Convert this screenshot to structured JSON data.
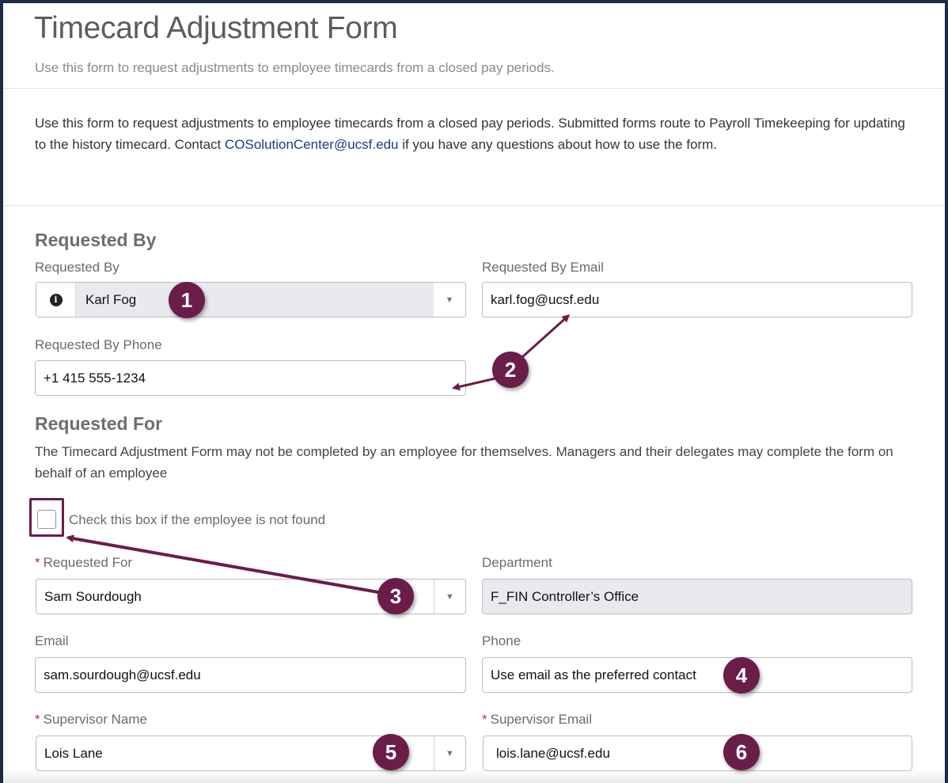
{
  "header": {
    "title": "Timecard Adjustment Form",
    "subtitle": "Use this form to request adjustments to employee timecards from a closed pay periods."
  },
  "intro": {
    "text_before": "Use this form to request adjustments to employee timecards from a closed pay periods. Submitted forms route to Payroll Timekeeping for updating to the history timecard. Contact ",
    "email_link": "COSolutionCenter@ucsf.edu",
    "text_after": " if you have any questions about how to use the form."
  },
  "requested_by": {
    "section_title": "Requested By",
    "name_label": "Requested By",
    "name_value": "Karl Fog",
    "email_label": "Requested By Email",
    "email_value": "karl.fog@ucsf.edu",
    "phone_label": "Requested By Phone",
    "phone_value": "+1 415 555-1234"
  },
  "requested_for": {
    "section_title": "Requested For",
    "description": "The Timecard Adjustment Form may not be completed by an employee for themselves. Managers and their delegates may complete the form on behalf of an employee",
    "checkbox_label": "Check this box if the employee is not found",
    "checkbox_checked": false,
    "name_label": "Requested For",
    "name_value": "Sam Sourdough",
    "department_label": "Department",
    "department_value": "F_FIN Controller’s Office",
    "email_label": "Email",
    "email_value": "sam.sourdough@ucsf.edu",
    "phone_label": "Phone",
    "phone_value": "Use email as the preferred contact",
    "supervisor_name_label": "Supervisor Name",
    "supervisor_name_value": "Lois Lane",
    "supervisor_email_label": "Supervisor Email",
    "supervisor_email_value": "lois.lane@ucsf.edu",
    "required_marker": "*"
  },
  "callouts": [
    "1",
    "2",
    "3",
    "4",
    "5",
    "6"
  ],
  "icons": {
    "info": "info-icon",
    "caret": "caret-down-icon"
  },
  "colors": {
    "callout": "#6b1d4a",
    "link": "#1f3b82",
    "required": "#c62828",
    "disabled_field": "#e8eaed",
    "frame_border": "#1f2a44"
  }
}
